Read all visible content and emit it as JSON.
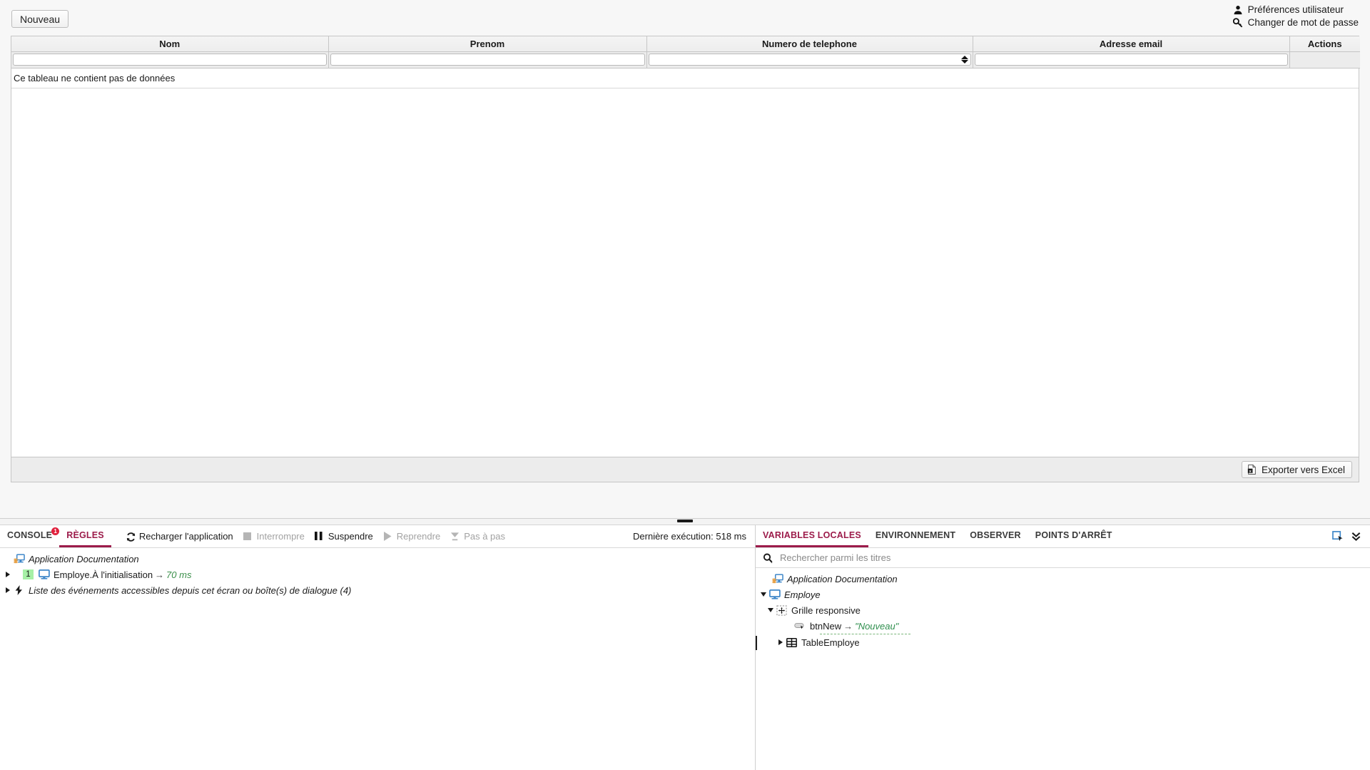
{
  "app": {
    "new_button": "Nouveau",
    "user_links": [
      {
        "label": "Préférences utilisateur",
        "icon": "user-icon"
      },
      {
        "label": "Changer de mot de passe",
        "icon": "key-icon"
      }
    ],
    "table": {
      "columns": [
        "Nom",
        "Prenom",
        "Numero de telephone",
        "Adresse email",
        "Actions"
      ],
      "filters": [
        "",
        "",
        "",
        "",
        ""
      ],
      "empty_message": "Ce tableau ne contient pas de données",
      "export_button": "Exporter vers Excel",
      "export_icon": "excel-file-icon"
    }
  },
  "debugger": {
    "left": {
      "tabs": [
        {
          "label": "CONSOLE",
          "active": false,
          "badge": "1"
        },
        {
          "label": "RÈGLES",
          "active": true,
          "badge": ""
        }
      ],
      "actions": [
        {
          "label": "Recharger l'application",
          "icon": "reload-icon",
          "disabled": false
        },
        {
          "label": "Interrompre",
          "icon": "stop-icon",
          "disabled": true
        },
        {
          "label": "Suspendre",
          "icon": "pause-icon",
          "disabled": false
        },
        {
          "label": "Reprendre",
          "icon": "play-icon",
          "disabled": true
        },
        {
          "label": "Pas à pas",
          "icon": "step-icon",
          "disabled": true
        }
      ],
      "exec_time": "Dernière exécution: 518 ms",
      "tree": [
        {
          "label": "Application Documentation",
          "icon": "app-doc-icon",
          "caret": "none",
          "italic": true,
          "indent": 0,
          "badge": "",
          "arrow": "",
          "value": ""
        },
        {
          "label": "Employe.À l'initialisation",
          "icon": "screen-icon",
          "caret": "right",
          "italic": false,
          "indent": 1,
          "badge": "1",
          "arrow": "→",
          "value": "70 ms"
        },
        {
          "label": "Liste des événements accessibles depuis cet écran ou boîte(s) de dialogue (4)",
          "icon": "bolt-icon",
          "caret": "right",
          "italic": true,
          "indent": 0,
          "badge": "",
          "arrow": "",
          "value": ""
        }
      ]
    },
    "right": {
      "tabs": [
        {
          "label": "VARIABLES LOCALES",
          "active": true
        },
        {
          "label": "ENVIRONNEMENT",
          "active": false
        },
        {
          "label": "OBSERVER",
          "active": false
        },
        {
          "label": "POINTS D'ARRÊT",
          "active": false
        }
      ],
      "panel_icons": [
        "select-element-icon",
        "collapse-all-icon"
      ],
      "search_placeholder": "Rechercher parmi les titres",
      "search_value": "",
      "search_icon": "search-icon",
      "tree": [
        {
          "label": "Application Documentation",
          "icon": "app-doc-icon",
          "caret": "none",
          "italic": true,
          "indent": 0,
          "arrow": "",
          "value": "",
          "marker": false
        },
        {
          "label": "Employe",
          "icon": "screen-icon",
          "caret": "down",
          "italic": true,
          "indent": 1,
          "arrow": "",
          "value": "",
          "marker": false
        },
        {
          "label": "Grille responsive",
          "icon": "responsive-grid-icon",
          "caret": "down",
          "italic": false,
          "indent": 2,
          "arrow": "",
          "value": "",
          "marker": false
        },
        {
          "label": "btnNew",
          "icon": "button-control-icon",
          "caret": "none",
          "italic": false,
          "indent": 3,
          "arrow": "→",
          "value": "\"Nouveau\"",
          "marker": false
        },
        {
          "label": "TableEmploye",
          "icon": "table-control-icon",
          "caret": "right",
          "italic": false,
          "indent": 2,
          "arrow": "",
          "value": "",
          "marker": true
        }
      ]
    }
  },
  "colors": {
    "accent": "#9c1b4a",
    "badge_red": "#e0203c",
    "count_green": "#a6f0a6",
    "value_green": "#2f8f4e",
    "icon_blue": "#3f87c9"
  }
}
